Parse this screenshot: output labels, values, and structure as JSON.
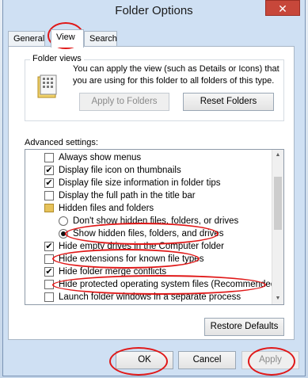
{
  "window": {
    "title": "Folder Options",
    "close_glyph": "✕"
  },
  "tabs": [
    {
      "label": "General"
    },
    {
      "label": "View"
    },
    {
      "label": "Search"
    }
  ],
  "folder_views": {
    "group_label": "Folder views",
    "description": "You can apply the view (such as Details or Icons) that you are using for this folder to all folders of this type.",
    "apply_button": "Apply to Folders",
    "reset_button": "Reset Folders"
  },
  "advanced": {
    "label": "Advanced settings:",
    "items": [
      {
        "label": "Always show menus",
        "type": "checkbox",
        "checked": false
      },
      {
        "label": "Display file icon on thumbnails",
        "type": "checkbox",
        "checked": true
      },
      {
        "label": "Display file size information in folder tips",
        "type": "checkbox",
        "checked": true
      },
      {
        "label": "Display the full path in the title bar",
        "type": "checkbox",
        "checked": false
      },
      {
        "label": "Hidden files and folders",
        "type": "folder"
      },
      {
        "label": "Don't show hidden files, folders, or drives",
        "type": "radio",
        "checked": false
      },
      {
        "label": "Show hidden files, folders, and drives",
        "type": "radio",
        "checked": true
      },
      {
        "label": "Hide empty drives in the Computer folder",
        "type": "checkbox",
        "checked": true
      },
      {
        "label": "Hide extensions for known file types",
        "type": "checkbox",
        "checked": false
      },
      {
        "label": "Hide folder merge conflicts",
        "type": "checkbox",
        "checked": true
      },
      {
        "label": "Hide protected operating system files (Recommended)",
        "type": "checkbox",
        "checked": false
      },
      {
        "label": "Launch folder windows in a separate process",
        "type": "checkbox",
        "checked": false
      }
    ],
    "restore_button": "Restore Defaults"
  },
  "footer": {
    "ok": "OK",
    "cancel": "Cancel",
    "apply": "Apply"
  },
  "colors": {
    "annotation_red": "#e01818",
    "titlebar": "#cfe0f3",
    "close_red": "#c7473a"
  }
}
